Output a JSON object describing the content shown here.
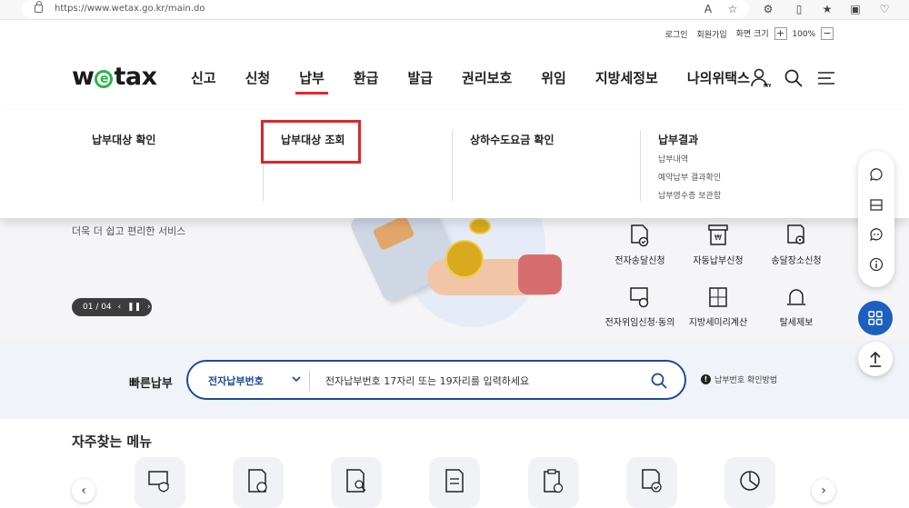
{
  "browser": {
    "url": "https://www.wetax.go.kr/main.do"
  },
  "utility": {
    "login": "로그인",
    "join": "회원가입",
    "zoom_label": "화면 크기",
    "zoom_value": "100%"
  },
  "logo": {
    "text_left": "w",
    "text_right": "tax"
  },
  "gnb": [
    "신고",
    "신청",
    "납부",
    "환급",
    "발급",
    "권리보호",
    "위임",
    "지방세정보",
    "나의위택스"
  ],
  "mega": {
    "col1": "납부대상 확인",
    "col2": "납부대상 조회",
    "col3": "상하수도요금 확인",
    "col4": "납부결과",
    "col4_items": [
      "납부내역",
      "예약납부 결과확인",
      "납부영수증 보관함"
    ]
  },
  "hero": {
    "subtitle": "더욱 더 쉽고 편리한 서비스",
    "pager": "01 / 04"
  },
  "quick_menu": [
    {
      "label": "전자송달신청"
    },
    {
      "label": "자동납부신청"
    },
    {
      "label": "송달장소신청"
    },
    {
      "label": "전자위임신청·동의"
    },
    {
      "label": "지방세미리계산"
    },
    {
      "label": "탈세제보"
    }
  ],
  "fastpay": {
    "label": "빠른납부",
    "select_value": "전자납부번호",
    "placeholder": "전자납부번호 17자리 또는 19자리를 입력하세요",
    "help": "납부번호 확인방법"
  },
  "frequent": {
    "title": "자주찾는 메뉴"
  },
  "colors": {
    "brand_green": "#2eb34b",
    "accent_red": "#e8262c",
    "primary_blue": "#1a4a9c"
  }
}
